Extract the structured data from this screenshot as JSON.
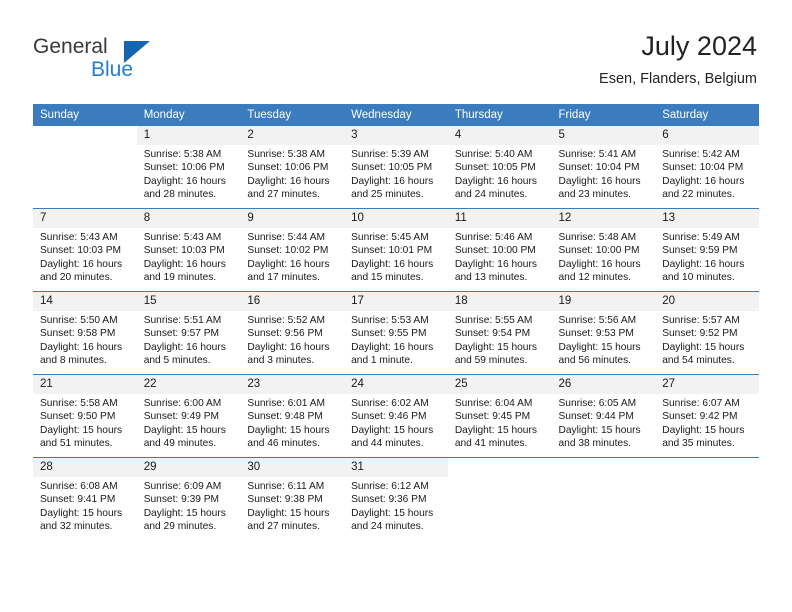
{
  "brand": {
    "name_part1": "General",
    "name_part2": "Blue",
    "triangle_color": "#1565b0",
    "blue_color": "#1f7fd0"
  },
  "header": {
    "title": "July 2024",
    "subtitle": "Esen, Flanders, Belgium",
    "header_bg_color": "#3a7cbe",
    "daynum_bg_color": "#f2f2f2"
  },
  "calendar": {
    "weekday_headers": [
      "Sunday",
      "Monday",
      "Tuesday",
      "Wednesday",
      "Thursday",
      "Friday",
      "Saturday"
    ],
    "weeks": [
      [
        {
          "day": "",
          "sunrise": "",
          "sunset": "",
          "daylight_line1": "",
          "daylight_line2": ""
        },
        {
          "day": "1",
          "sunrise": "Sunrise: 5:38 AM",
          "sunset": "Sunset: 10:06 PM",
          "daylight_line1": "Daylight: 16 hours",
          "daylight_line2": "and 28 minutes."
        },
        {
          "day": "2",
          "sunrise": "Sunrise: 5:38 AM",
          "sunset": "Sunset: 10:06 PM",
          "daylight_line1": "Daylight: 16 hours",
          "daylight_line2": "and 27 minutes."
        },
        {
          "day": "3",
          "sunrise": "Sunrise: 5:39 AM",
          "sunset": "Sunset: 10:05 PM",
          "daylight_line1": "Daylight: 16 hours",
          "daylight_line2": "and 25 minutes."
        },
        {
          "day": "4",
          "sunrise": "Sunrise: 5:40 AM",
          "sunset": "Sunset: 10:05 PM",
          "daylight_line1": "Daylight: 16 hours",
          "daylight_line2": "and 24 minutes."
        },
        {
          "day": "5",
          "sunrise": "Sunrise: 5:41 AM",
          "sunset": "Sunset: 10:04 PM",
          "daylight_line1": "Daylight: 16 hours",
          "daylight_line2": "and 23 minutes."
        },
        {
          "day": "6",
          "sunrise": "Sunrise: 5:42 AM",
          "sunset": "Sunset: 10:04 PM",
          "daylight_line1": "Daylight: 16 hours",
          "daylight_line2": "and 22 minutes."
        }
      ],
      [
        {
          "day": "7",
          "sunrise": "Sunrise: 5:43 AM",
          "sunset": "Sunset: 10:03 PM",
          "daylight_line1": "Daylight: 16 hours",
          "daylight_line2": "and 20 minutes."
        },
        {
          "day": "8",
          "sunrise": "Sunrise: 5:43 AM",
          "sunset": "Sunset: 10:03 PM",
          "daylight_line1": "Daylight: 16 hours",
          "daylight_line2": "and 19 minutes."
        },
        {
          "day": "9",
          "sunrise": "Sunrise: 5:44 AM",
          "sunset": "Sunset: 10:02 PM",
          "daylight_line1": "Daylight: 16 hours",
          "daylight_line2": "and 17 minutes."
        },
        {
          "day": "10",
          "sunrise": "Sunrise: 5:45 AM",
          "sunset": "Sunset: 10:01 PM",
          "daylight_line1": "Daylight: 16 hours",
          "daylight_line2": "and 15 minutes."
        },
        {
          "day": "11",
          "sunrise": "Sunrise: 5:46 AM",
          "sunset": "Sunset: 10:00 PM",
          "daylight_line1": "Daylight: 16 hours",
          "daylight_line2": "and 13 minutes."
        },
        {
          "day": "12",
          "sunrise": "Sunrise: 5:48 AM",
          "sunset": "Sunset: 10:00 PM",
          "daylight_line1": "Daylight: 16 hours",
          "daylight_line2": "and 12 minutes."
        },
        {
          "day": "13",
          "sunrise": "Sunrise: 5:49 AM",
          "sunset": "Sunset: 9:59 PM",
          "daylight_line1": "Daylight: 16 hours",
          "daylight_line2": "and 10 minutes."
        }
      ],
      [
        {
          "day": "14",
          "sunrise": "Sunrise: 5:50 AM",
          "sunset": "Sunset: 9:58 PM",
          "daylight_line1": "Daylight: 16 hours",
          "daylight_line2": "and 8 minutes."
        },
        {
          "day": "15",
          "sunrise": "Sunrise: 5:51 AM",
          "sunset": "Sunset: 9:57 PM",
          "daylight_line1": "Daylight: 16 hours",
          "daylight_line2": "and 5 minutes."
        },
        {
          "day": "16",
          "sunrise": "Sunrise: 5:52 AM",
          "sunset": "Sunset: 9:56 PM",
          "daylight_line1": "Daylight: 16 hours",
          "daylight_line2": "and 3 minutes."
        },
        {
          "day": "17",
          "sunrise": "Sunrise: 5:53 AM",
          "sunset": "Sunset: 9:55 PM",
          "daylight_line1": "Daylight: 16 hours",
          "daylight_line2": "and 1 minute."
        },
        {
          "day": "18",
          "sunrise": "Sunrise: 5:55 AM",
          "sunset": "Sunset: 9:54 PM",
          "daylight_line1": "Daylight: 15 hours",
          "daylight_line2": "and 59 minutes."
        },
        {
          "day": "19",
          "sunrise": "Sunrise: 5:56 AM",
          "sunset": "Sunset: 9:53 PM",
          "daylight_line1": "Daylight: 15 hours",
          "daylight_line2": "and 56 minutes."
        },
        {
          "day": "20",
          "sunrise": "Sunrise: 5:57 AM",
          "sunset": "Sunset: 9:52 PM",
          "daylight_line1": "Daylight: 15 hours",
          "daylight_line2": "and 54 minutes."
        }
      ],
      [
        {
          "day": "21",
          "sunrise": "Sunrise: 5:58 AM",
          "sunset": "Sunset: 9:50 PM",
          "daylight_line1": "Daylight: 15 hours",
          "daylight_line2": "and 51 minutes."
        },
        {
          "day": "22",
          "sunrise": "Sunrise: 6:00 AM",
          "sunset": "Sunset: 9:49 PM",
          "daylight_line1": "Daylight: 15 hours",
          "daylight_line2": "and 49 minutes."
        },
        {
          "day": "23",
          "sunrise": "Sunrise: 6:01 AM",
          "sunset": "Sunset: 9:48 PM",
          "daylight_line1": "Daylight: 15 hours",
          "daylight_line2": "and 46 minutes."
        },
        {
          "day": "24",
          "sunrise": "Sunrise: 6:02 AM",
          "sunset": "Sunset: 9:46 PM",
          "daylight_line1": "Daylight: 15 hours",
          "daylight_line2": "and 44 minutes."
        },
        {
          "day": "25",
          "sunrise": "Sunrise: 6:04 AM",
          "sunset": "Sunset: 9:45 PM",
          "daylight_line1": "Daylight: 15 hours",
          "daylight_line2": "and 41 minutes."
        },
        {
          "day": "26",
          "sunrise": "Sunrise: 6:05 AM",
          "sunset": "Sunset: 9:44 PM",
          "daylight_line1": "Daylight: 15 hours",
          "daylight_line2": "and 38 minutes."
        },
        {
          "day": "27",
          "sunrise": "Sunrise: 6:07 AM",
          "sunset": "Sunset: 9:42 PM",
          "daylight_line1": "Daylight: 15 hours",
          "daylight_line2": "and 35 minutes."
        }
      ],
      [
        {
          "day": "28",
          "sunrise": "Sunrise: 6:08 AM",
          "sunset": "Sunset: 9:41 PM",
          "daylight_line1": "Daylight: 15 hours",
          "daylight_line2": "and 32 minutes."
        },
        {
          "day": "29",
          "sunrise": "Sunrise: 6:09 AM",
          "sunset": "Sunset: 9:39 PM",
          "daylight_line1": "Daylight: 15 hours",
          "daylight_line2": "and 29 minutes."
        },
        {
          "day": "30",
          "sunrise": "Sunrise: 6:11 AM",
          "sunset": "Sunset: 9:38 PM",
          "daylight_line1": "Daylight: 15 hours",
          "daylight_line2": "and 27 minutes."
        },
        {
          "day": "31",
          "sunrise": "Sunrise: 6:12 AM",
          "sunset": "Sunset: 9:36 PM",
          "daylight_line1": "Daylight: 15 hours",
          "daylight_line2": "and 24 minutes."
        },
        {
          "day": "",
          "sunrise": "",
          "sunset": "",
          "daylight_line1": "",
          "daylight_line2": ""
        },
        {
          "day": "",
          "sunrise": "",
          "sunset": "",
          "daylight_line1": "",
          "daylight_line2": ""
        },
        {
          "day": "",
          "sunrise": "",
          "sunset": "",
          "daylight_line1": "",
          "daylight_line2": ""
        }
      ]
    ]
  }
}
